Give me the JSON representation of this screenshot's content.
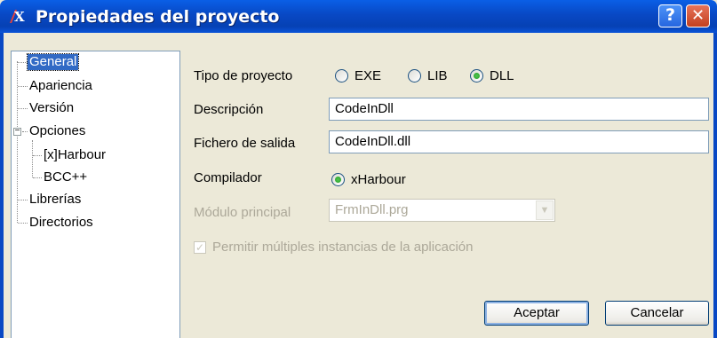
{
  "window": {
    "title": "Propiedades del proyecto",
    "help_label": "?",
    "close_label": "✕"
  },
  "tree": {
    "items": [
      {
        "label": "General"
      },
      {
        "label": "Apariencia"
      },
      {
        "label": "Versión"
      },
      {
        "label": "Opciones",
        "expanded": true,
        "children": [
          {
            "label": "[x]Harbour"
          },
          {
            "label": "BCC++"
          }
        ]
      },
      {
        "label": "Librerías"
      },
      {
        "label": "Directorios"
      }
    ],
    "selected": "General"
  },
  "form": {
    "tipo_label": "Tipo de proyecto",
    "tipo_options": [
      "EXE",
      "LIB",
      "DLL"
    ],
    "tipo_selected": "DLL",
    "descripcion_label": "Descripción",
    "descripcion_value": "CodeInDll",
    "fichero_label": "Fichero de salida",
    "fichero_value": "CodeInDll.dll",
    "compilador_label": "Compilador",
    "compilador_option": "xHarbour",
    "modulo_label": "Módulo principal",
    "modulo_value": "FrmInDll.prg",
    "multiples_label": "Permitir múltiples instancias de la aplicación",
    "multiples_checked": true
  },
  "buttons": {
    "accept": "Aceptar",
    "cancel": "Cancelar"
  },
  "colors": {
    "title_bar": "#0848c4",
    "selection": "#316ac5",
    "radio_dot": "#21a121"
  }
}
